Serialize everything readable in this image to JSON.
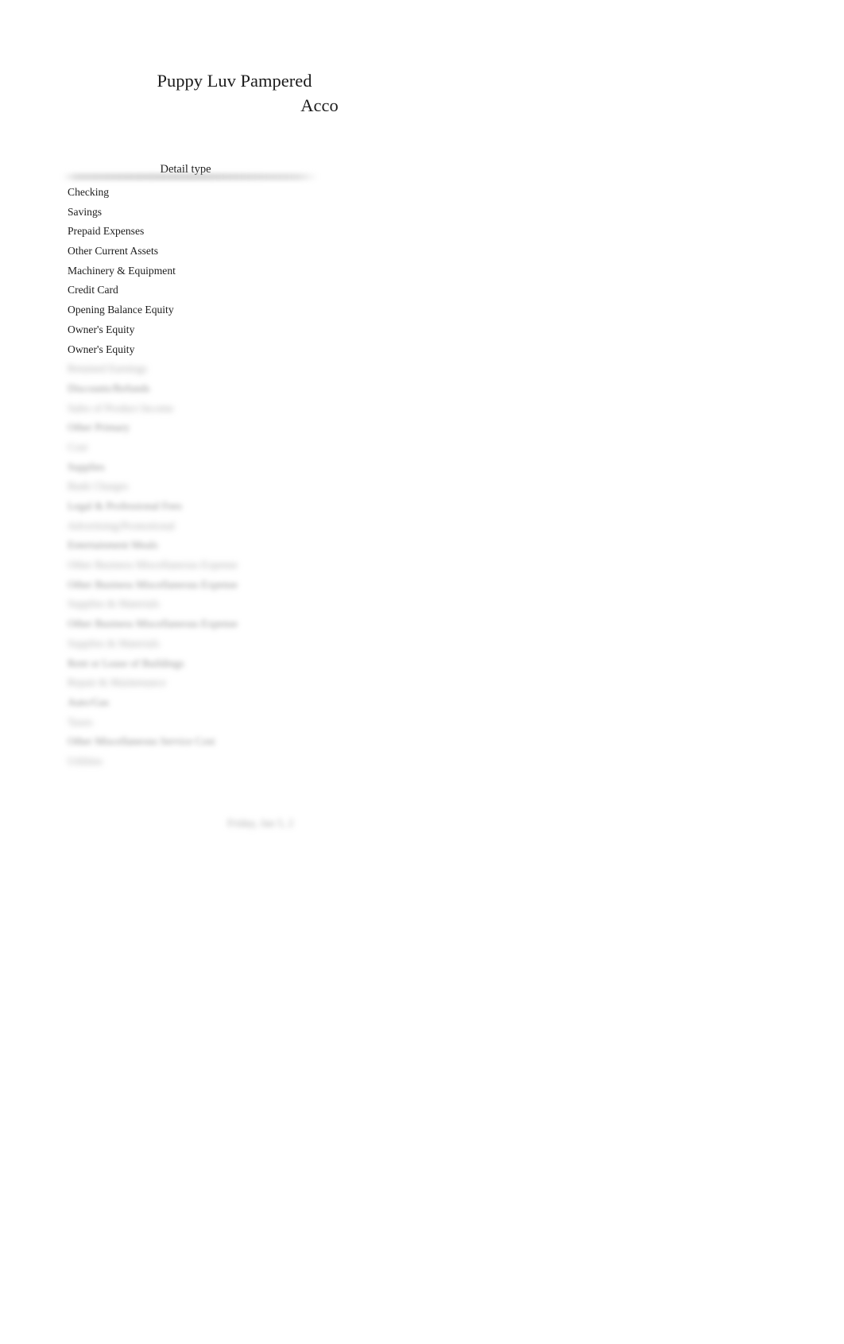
{
  "document": {
    "title_line_1": "Puppy Luv Pampered",
    "title_line_2": "Acco"
  },
  "table": {
    "column_header": "Detail type",
    "rows": [
      {
        "label": "Checking",
        "legible": true
      },
      {
        "label": "Savings",
        "legible": true
      },
      {
        "label": "Prepaid Expenses",
        "legible": true
      },
      {
        "label": "Other Current Assets",
        "legible": true
      },
      {
        "label": "Machinery & Equipment",
        "legible": true
      },
      {
        "label": "Credit Card",
        "legible": true
      },
      {
        "label": "Opening Balance Equity",
        "legible": true
      },
      {
        "label": "Owner's Equity",
        "legible": true
      },
      {
        "label": "Owner's Equity",
        "legible": true
      },
      {
        "label": "Retained Earnings",
        "legible": false
      },
      {
        "label": "Discounts/Refunds",
        "legible": false
      },
      {
        "label": "Sales of Product Income",
        "legible": false
      },
      {
        "label": "Other Primary",
        "legible": false
      },
      {
        "label": "Cost",
        "legible": false
      },
      {
        "label": "Supplies",
        "legible": false
      },
      {
        "label": "Bank Charges",
        "legible": false
      },
      {
        "label": "Legal & Professional Fees",
        "legible": false
      },
      {
        "label": "Advertising/Promotional",
        "legible": false
      },
      {
        "label": "Entertainment Meals",
        "legible": false
      },
      {
        "label": "Other Business Miscellaneous Expense",
        "legible": false
      },
      {
        "label": "Other Business Miscellaneous Expense",
        "legible": false
      },
      {
        "label": "Supplies & Materials",
        "legible": false
      },
      {
        "label": "Other Business Miscellaneous Expense",
        "legible": false
      },
      {
        "label": "Supplies & Materials",
        "legible": false
      },
      {
        "label": "Rent or Lease of Buildings",
        "legible": false
      },
      {
        "label": "Repair & Maintenance",
        "legible": false
      },
      {
        "label": "Auto/Gas",
        "legible": false
      },
      {
        "label": "Taxes",
        "legible": false
      },
      {
        "label": "Other Miscellaneous Service Cost",
        "legible": false
      },
      {
        "label": "Utilities",
        "legible": false
      }
    ]
  },
  "footer": {
    "fragment": "Friday, Jan 5, 2"
  }
}
